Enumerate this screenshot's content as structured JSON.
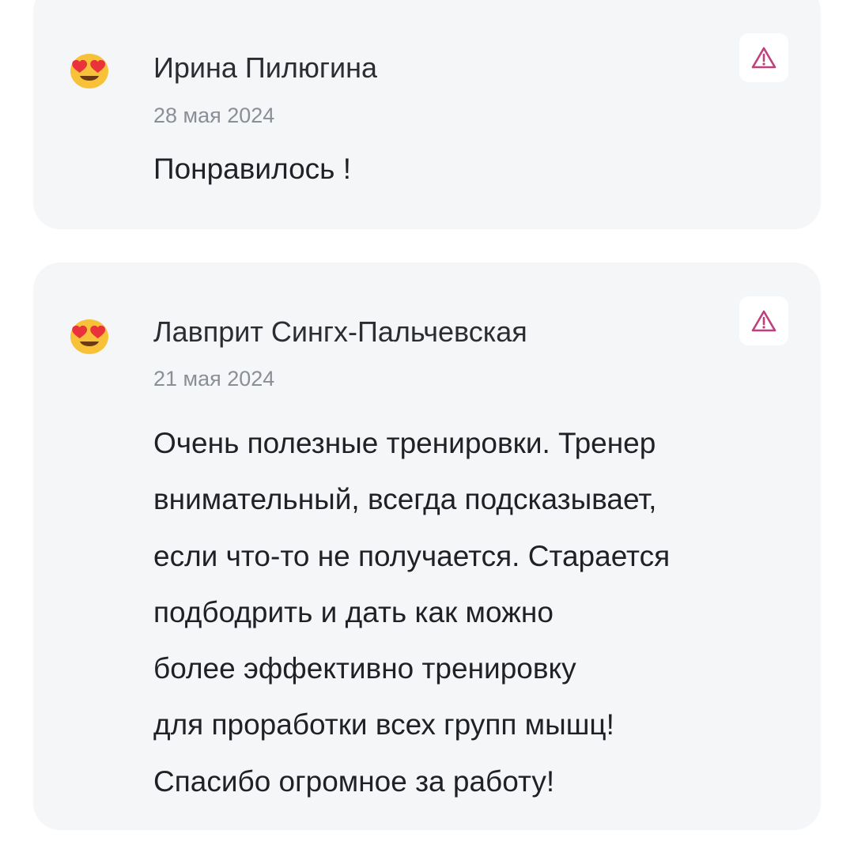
{
  "reviews": [
    {
      "author": "Ирина Пилюгина",
      "date": "28 мая 2024",
      "text": "Понравилось !",
      "avatar_icon": "heart-eyes-emoji",
      "report_icon": "warning-triangle-icon"
    },
    {
      "author": "Лавприт Сингх-Пальчевская",
      "date": "21 мая 2024",
      "text_lines": [
        "Очень полезные тренировки. Тренер",
        "внимательный, всегда подсказывает,",
        "если что-то не получается. Старается",
        "подбодрить и дать как можно",
        "более эффективно тренировку",
        "для проработки всех групп мышц!",
        "Спасибо огромное за работу!"
      ],
      "avatar_icon": "heart-eyes-emoji",
      "report_icon": "warning-triangle-icon"
    }
  ],
  "colors": {
    "card_background": "#f5f6f8",
    "report_icon": "#c0407e",
    "author_text": "#2b2d33",
    "date_text": "#8a8e96"
  }
}
